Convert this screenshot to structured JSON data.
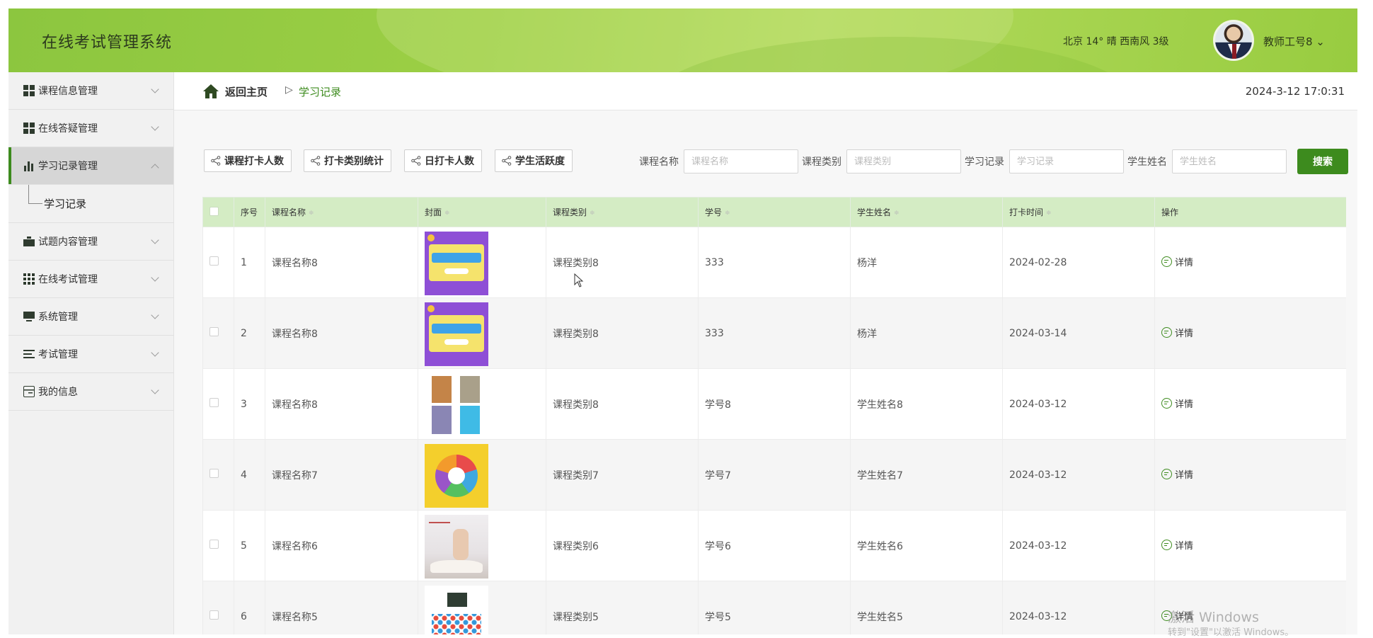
{
  "header": {
    "app_title": "在线考试管理系统",
    "weather": "北京 14° 晴 西南风 3级",
    "user_name": "教师工号8 ⌄"
  },
  "sidebar": {
    "items": [
      {
        "label": "课程信息管理",
        "icon": "grid-icon"
      },
      {
        "label": "在线答疑管理",
        "icon": "grid-icon"
      },
      {
        "label": "学习记录管理",
        "icon": "bar-chart-icon",
        "expanded": true
      },
      {
        "label": "试题内容管理",
        "icon": "briefcase-icon"
      },
      {
        "label": "在线考试管理",
        "icon": "tiles-icon"
      },
      {
        "label": "系统管理",
        "icon": "monitor-icon"
      },
      {
        "label": "考试管理",
        "icon": "list-icon"
      },
      {
        "label": "我的信息",
        "icon": "card-icon"
      }
    ],
    "sub_item": "学习记录"
  },
  "breadcrumb": {
    "home": "返回主页",
    "separator": "▷",
    "current": "学习记录"
  },
  "datetime": "2024-3-12 17:0:31",
  "toolbar": {
    "buttons": [
      "课程打卡人数",
      "打卡类别统计",
      "日打卡人数",
      "学生活跃度"
    ],
    "filters": [
      {
        "label": "课程名称",
        "placeholder": "课程名称"
      },
      {
        "label": "课程类别",
        "placeholder": "课程类别"
      },
      {
        "label": "学习记录",
        "placeholder": "学习记录"
      },
      {
        "label": "学生姓名",
        "placeholder": "学生姓名"
      }
    ],
    "search_label": "搜索"
  },
  "table": {
    "headers": {
      "index": "序号",
      "course_name": "课程名称",
      "cover": "封面",
      "course_type": "课程类别",
      "student_no": "学号",
      "student_name": "学生姓名",
      "checkin_time": "打卡时间",
      "action": "操作"
    },
    "sort_icon": "≑",
    "action_label": "详情",
    "rows": [
      {
        "index": "1",
        "course_name": "课程名称8",
        "cover": "chemistry-poster",
        "course_type": "课程类别8",
        "student_no": "333",
        "student_name": "杨洋",
        "checkin_time": "2024-02-28"
      },
      {
        "index": "2",
        "course_name": "课程名称8",
        "cover": "chemistry-poster",
        "course_type": "课程类别8",
        "student_no": "333",
        "student_name": "杨洋",
        "checkin_time": "2024-03-14"
      },
      {
        "index": "3",
        "course_name": "课程名称8",
        "cover": "book-collage",
        "course_type": "课程类别8",
        "student_no": "学号8",
        "student_name": "学生姓名8",
        "checkin_time": "2024-03-12"
      },
      {
        "index": "4",
        "course_name": "课程名称7",
        "cover": "colorful-wheel",
        "course_type": "课程类别7",
        "student_no": "学号7",
        "student_name": "学生姓名7",
        "checkin_time": "2024-03-12"
      },
      {
        "index": "5",
        "course_name": "课程名称6",
        "cover": "open-book-hand",
        "course_type": "课程类别6",
        "student_no": "学号6",
        "student_name": "学生姓名6",
        "checkin_time": "2024-03-12"
      },
      {
        "index": "6",
        "course_name": "课程名称5",
        "cover": "chalkboard-tree",
        "course_type": "课程类别5",
        "student_no": "学号5",
        "student_name": "学生姓名5",
        "checkin_time": "2024-03-12"
      }
    ]
  },
  "watermark": {
    "line1": "激活 Windows",
    "line2": "转到\"设置\"以激活 Windows。"
  },
  "colors": {
    "header_green": "#9ccf45",
    "accent_green": "#3d8b1e",
    "table_header": "#d4ecc4"
  }
}
